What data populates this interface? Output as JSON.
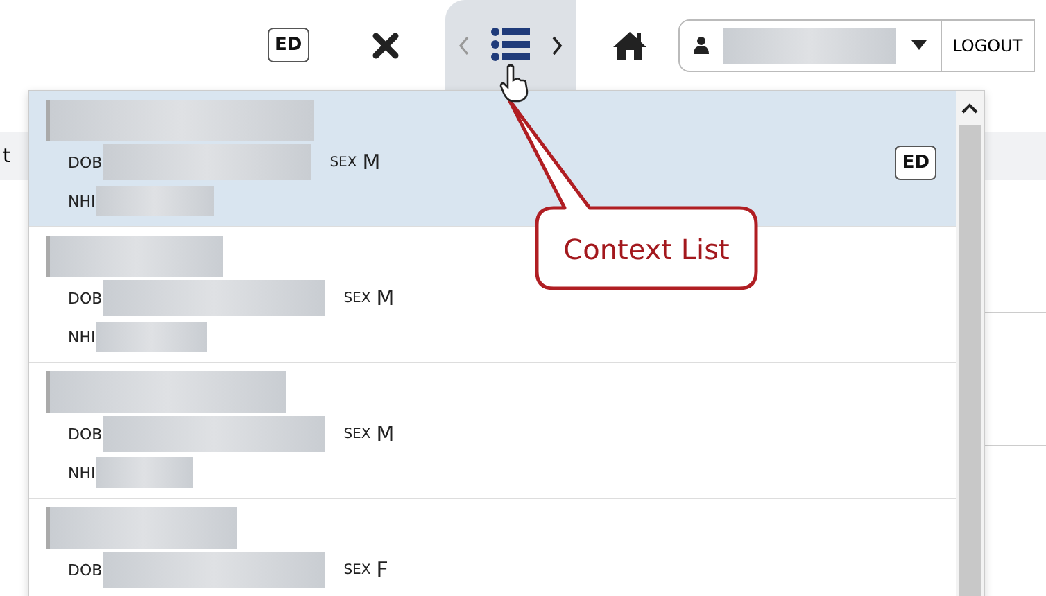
{
  "toolbar": {
    "badge": "ED",
    "logout": "LOGOUT"
  },
  "background_fragment": "t",
  "context_list": {
    "patients": [
      {
        "selected": true,
        "dob_label": "DOB",
        "nhi_label": "NHI",
        "sex_label": "SEX",
        "sex": "M",
        "badge": "ED"
      },
      {
        "selected": false,
        "dob_label": "DOB",
        "nhi_label": "NHI",
        "sex_label": "SEX",
        "sex": "M"
      },
      {
        "selected": false,
        "dob_label": "DOB",
        "nhi_label": "NHI",
        "sex_label": "SEX",
        "sex": "M"
      },
      {
        "selected": false,
        "dob_label": "DOB",
        "sex_label": "SEX",
        "sex": "F"
      }
    ]
  },
  "callout": {
    "text": "Context List"
  }
}
